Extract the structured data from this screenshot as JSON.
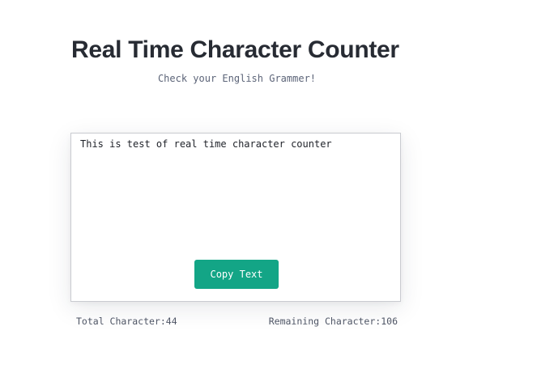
{
  "header": {
    "title": "Real Time Character Counter",
    "subtitle": "Check your English Grammer!"
  },
  "editor": {
    "value": "This is test of real time character counter",
    "placeholder": ""
  },
  "actions": {
    "copy_label": "Copy Text"
  },
  "stats": {
    "total_label": "Total Character:",
    "total_value": "44",
    "remaining_label": "Remaining Character:",
    "remaining_value": "106"
  },
  "colors": {
    "accent": "#13a586",
    "title": "#272b33",
    "muted": "#5c6478"
  }
}
